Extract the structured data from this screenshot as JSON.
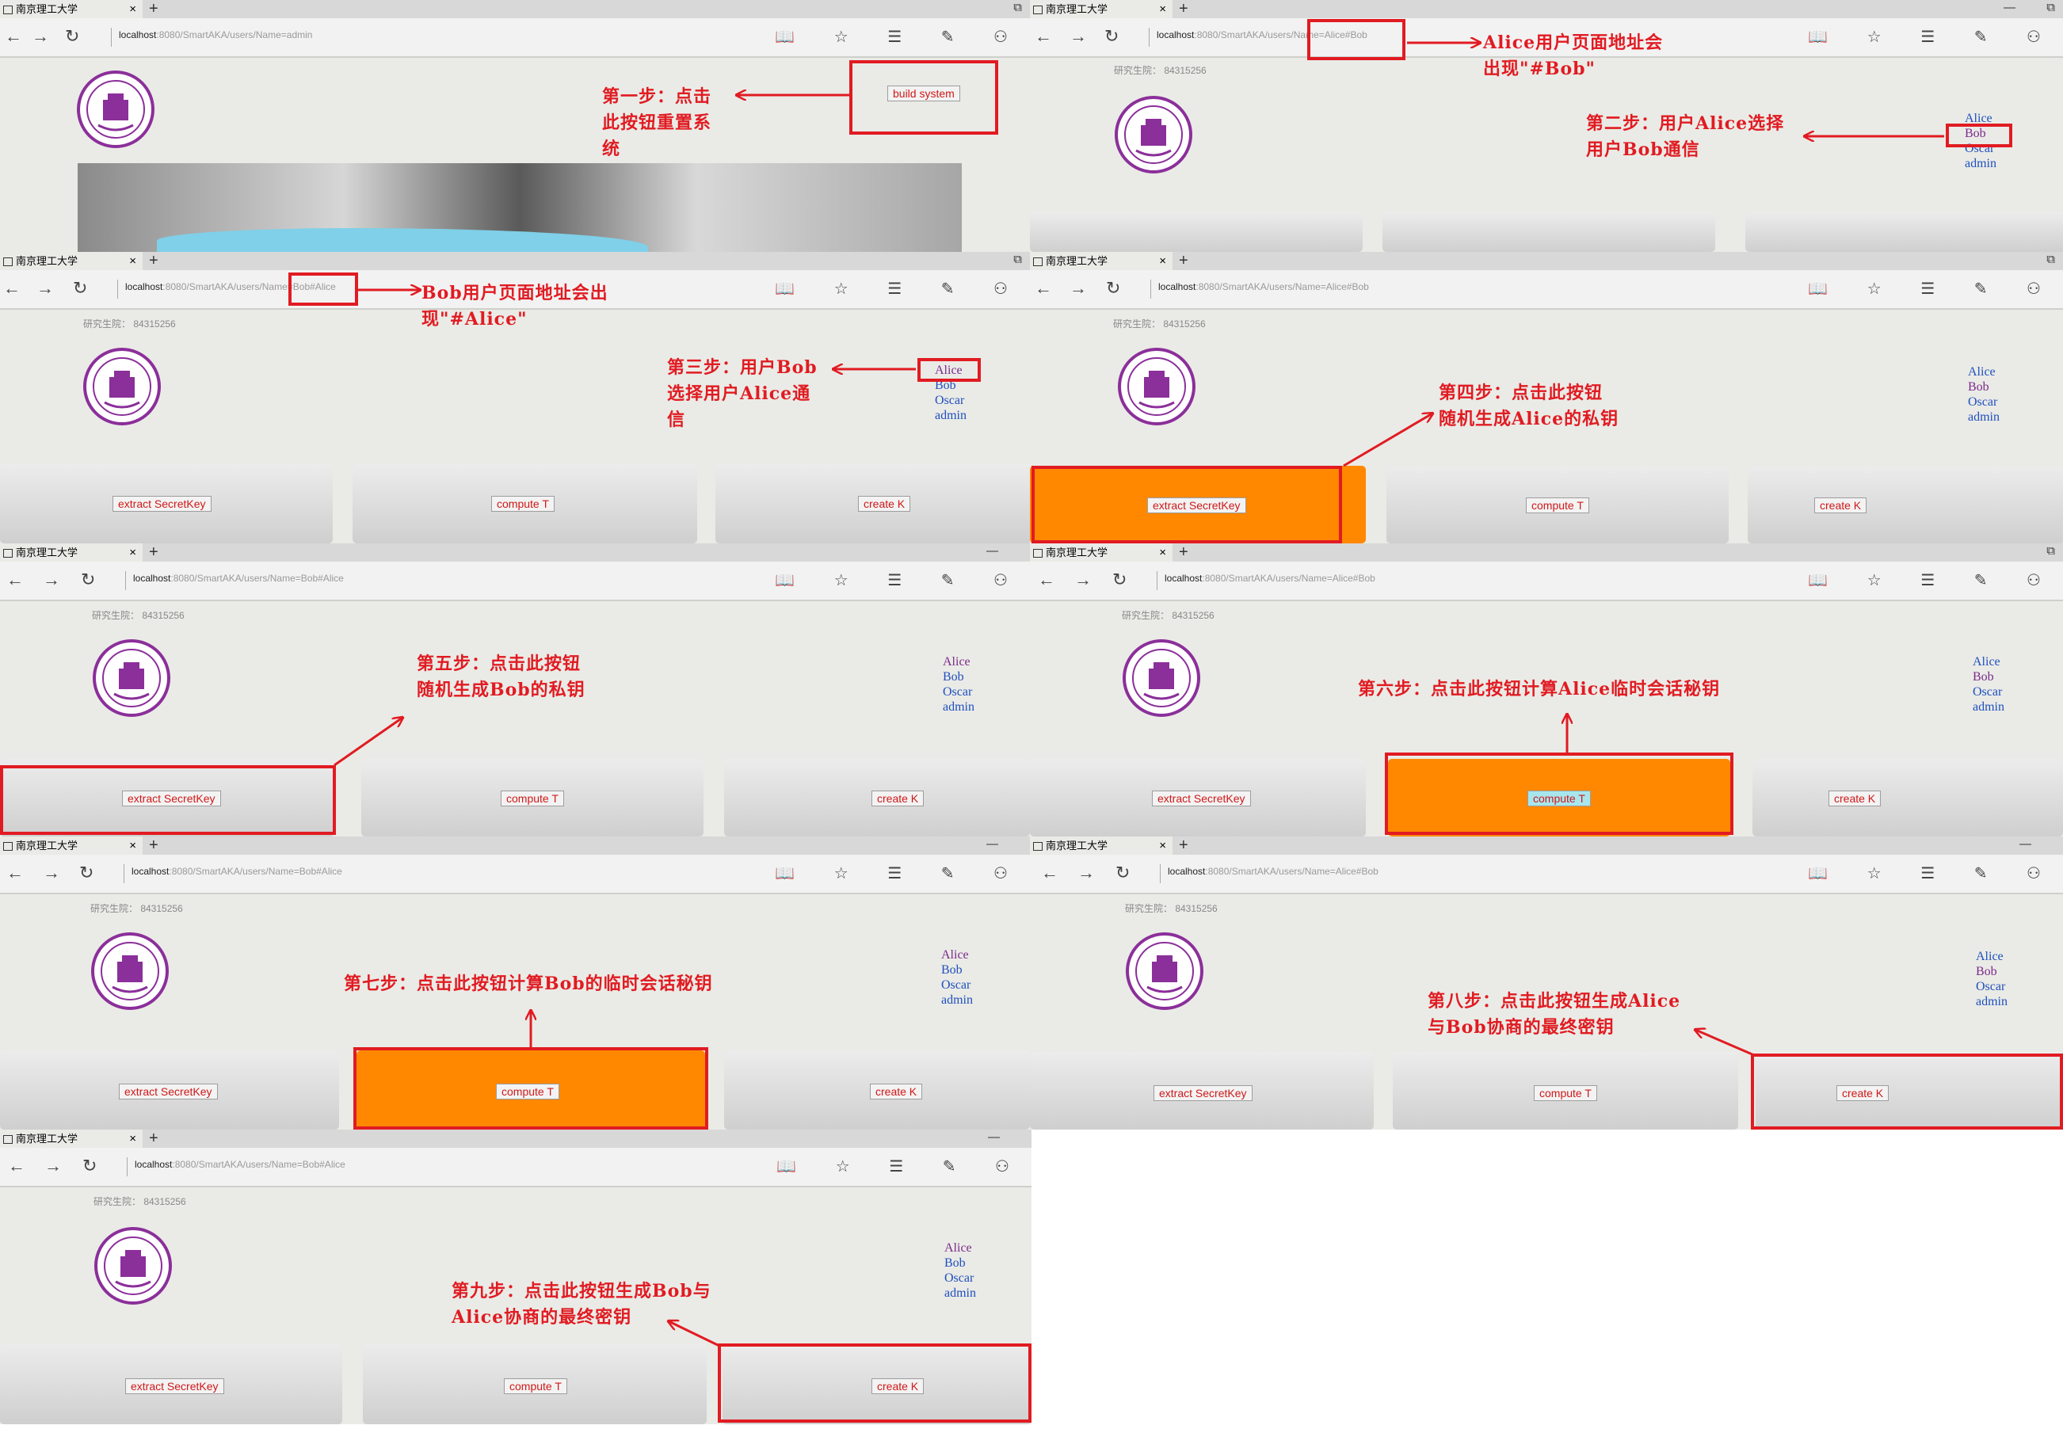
{
  "browser": {
    "tab_title": "南京理工大学",
    "new_tab": "+",
    "tab_close": "×",
    "nav": {
      "back": "←",
      "forward": "→",
      "reload": "↻"
    },
    "toolbar_icons": "📖 ☆ ☰ ✎ ⚇",
    "window_controls": {
      "minimize": "—",
      "restore": "⧉"
    },
    "url_host": "localhost",
    "url_path_admin": ":8080/SmartAKA/users/Name=admin",
    "url_path_alice": ":8080/SmartAKA/users/Name=Alice#Bob",
    "url_path_bob": ":8080/SmartAKA/users/Name=Bob#Alice"
  },
  "page": {
    "info_line": "研究生院：  84315256",
    "logo_caption": "南京理工大学",
    "users": [
      "Alice",
      "Bob",
      "Oscar",
      "admin"
    ]
  },
  "buttons": {
    "build": "build system",
    "extract": "extract SecretKey",
    "compute": "compute T",
    "create": "create K"
  },
  "annotations": {
    "step1": "第一步：点击\n此按钮重置系\n统",
    "alice_url": "Alice用户页面地址会\n出现\"#Bob\"",
    "step2": "第二步：用户Alice选择\n用户Bob通信",
    "bob_url": "Bob用户页面地址会出\n现\"#Alice\"",
    "step3": "第三步：用户Bob\n选择用户Alice通\n信",
    "step4": "第四步：点击此按钮\n随机生成Alice的私钥",
    "step5": "第五步：点击此按钮\n随机生成Bob的私钥",
    "step6": "第六步：点击此按钮计算Alice临时会话秘钥",
    "step7": "第七步：点击此按钮计算Bob的临时会话秘钥",
    "step8": "第八步：点击此按钮生成Alice\n与Bob协商的最终密钥",
    "step9": "第九步：点击此按钮生成Bob与\nAlice协商的最终密钥"
  },
  "colors": {
    "annotation_red": "#e11b22",
    "highlight_orange": "#ff8800",
    "button_text_red": "#d01818",
    "link_blue": "#1f4fbf",
    "visited_purple": "#7b2a8c"
  }
}
